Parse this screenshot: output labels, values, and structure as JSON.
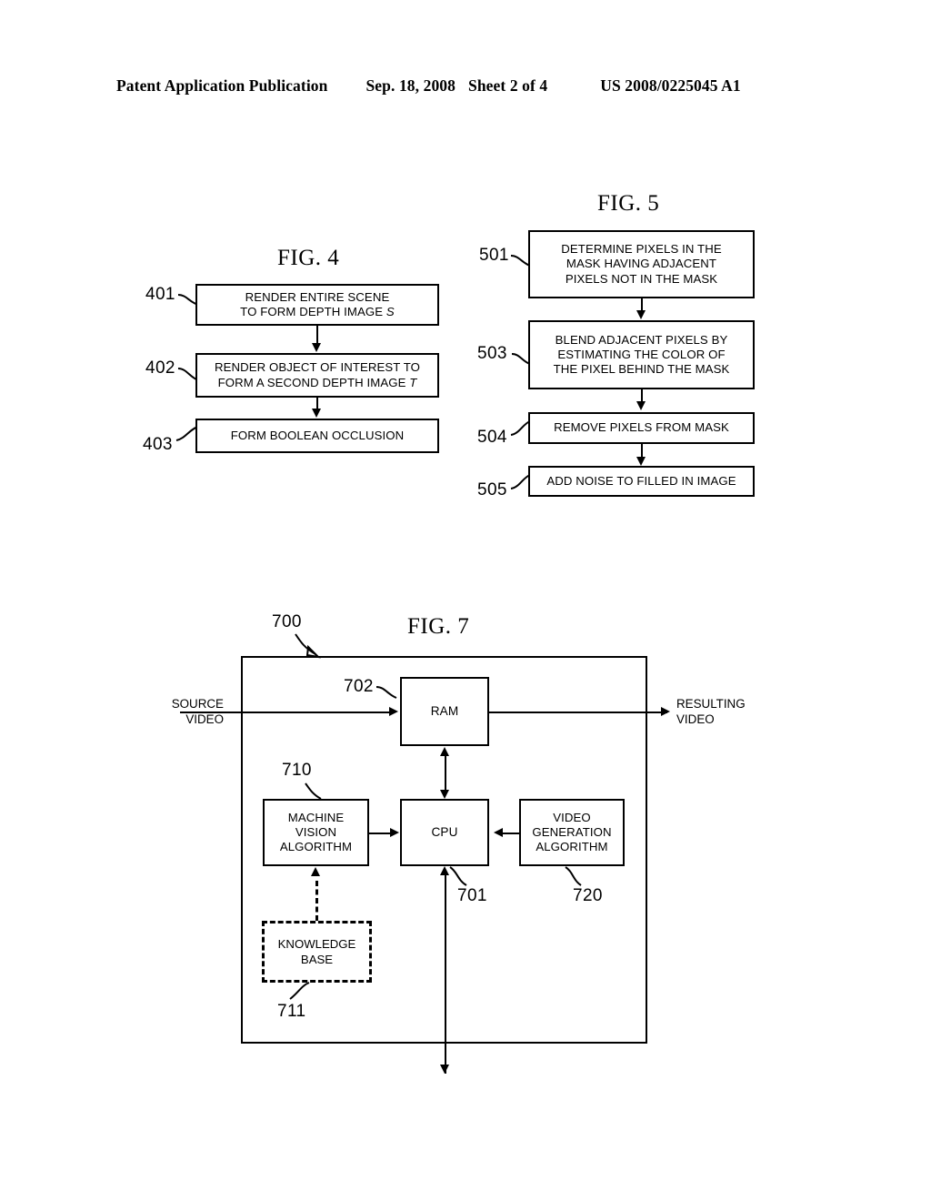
{
  "header": {
    "left": "Patent Application Publication",
    "date": "Sep. 18, 2008",
    "sheet": "Sheet 2 of 4",
    "patent_number": "US 2008/0225045 A1"
  },
  "fig4": {
    "title": "FIG. 4",
    "steps": [
      {
        "ref": "401",
        "lines": [
          "RENDER ENTIRE SCENE",
          "TO FORM DEPTH IMAGE "
        ],
        "italic_tail": "S"
      },
      {
        "ref": "402",
        "lines": [
          "RENDER OBJECT OF INTEREST TO",
          "FORM A SECOND DEPTH IMAGE "
        ],
        "italic_tail": "T"
      },
      {
        "ref": "403",
        "lines": [
          "FORM BOOLEAN OCCLUSION"
        ],
        "italic_tail": ""
      }
    ]
  },
  "fig5": {
    "title": "FIG. 5",
    "steps": [
      {
        "ref": "501",
        "lines": [
          "DETERMINE PIXELS IN THE",
          "MASK HAVING ADJACENT",
          "PIXELS NOT IN THE MASK"
        ]
      },
      {
        "ref": "503",
        "lines": [
          "BLEND ADJACENT PIXELS BY",
          "ESTIMATING THE COLOR OF",
          "THE PIXEL BEHIND THE MASK"
        ]
      },
      {
        "ref": "504",
        "lines": [
          "REMOVE PIXELS FROM MASK"
        ]
      },
      {
        "ref": "505",
        "lines": [
          "ADD NOISE TO FILLED IN IMAGE"
        ]
      }
    ]
  },
  "fig7": {
    "title": "FIG. 7",
    "system_ref": "700",
    "input_label": [
      "SOURCE",
      "VIDEO"
    ],
    "output_label": [
      "RESULTING",
      "VIDEO"
    ],
    "blocks": {
      "ram": {
        "ref": "702",
        "lines": [
          "RAM"
        ]
      },
      "cpu": {
        "ref": "701",
        "lines": [
          "CPU"
        ]
      },
      "mva": {
        "ref": "710",
        "lines": [
          "MACHINE",
          "VISION",
          "ALGORITHM"
        ]
      },
      "vga": {
        "ref": "720",
        "lines": [
          "VIDEO",
          "GENERATION",
          "ALGORITHM"
        ]
      },
      "kb": {
        "ref": "711",
        "lines": [
          "KNOWLEDGE",
          "BASE"
        ]
      }
    }
  }
}
